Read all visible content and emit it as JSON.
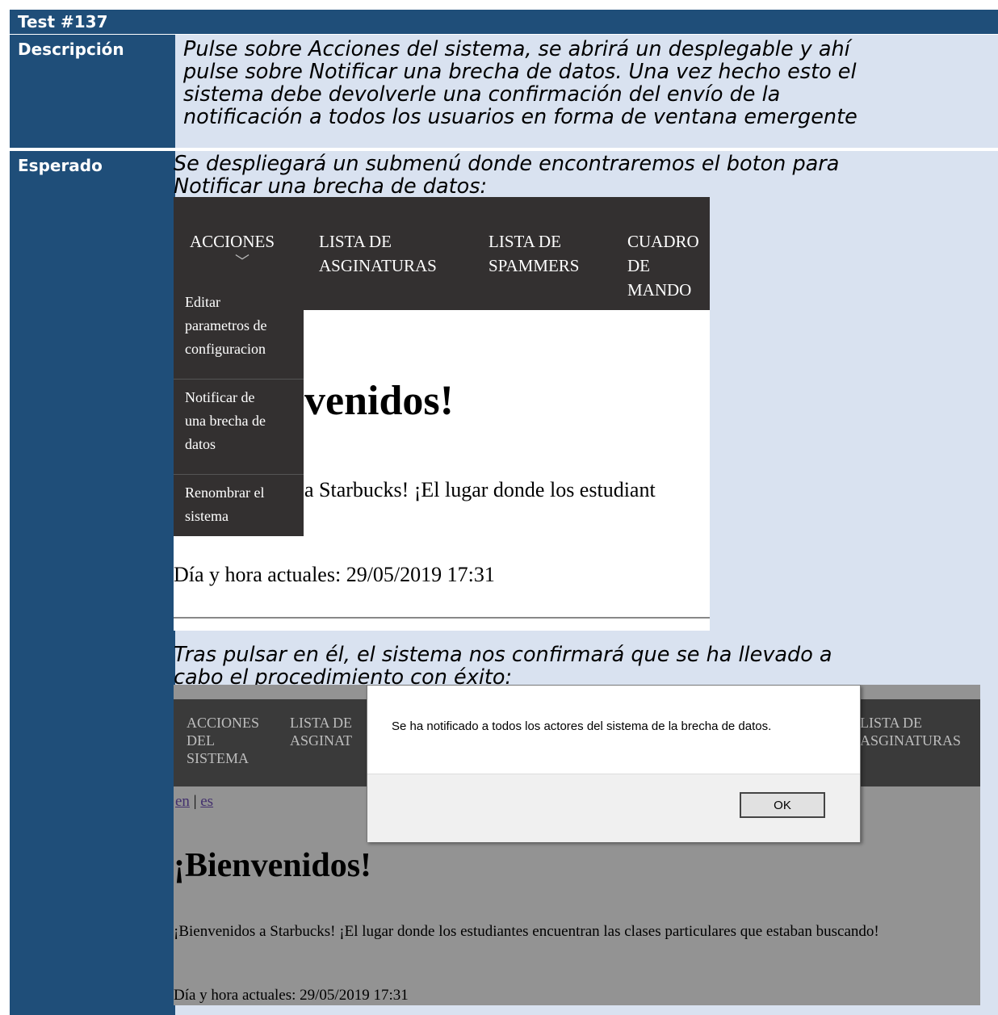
{
  "test": {
    "title": "Test #137"
  },
  "rows": {
    "description": {
      "label": "Descripción",
      "lines": [
        "Pulse sobre Acciones del sistema, se abrirá un desplegable y ahí",
        "pulse sobre Notificar una brecha de datos. Una vez hecho esto el",
        "sistema debe devolverle una confirmación del envío de la",
        "notificación a todos los usuarios en forma de ventana emergente"
      ]
    },
    "expected": {
      "label": "Esperado",
      "intro_lines": [
        "Se despliegará un submenú donde encontraremos el boton para",
        "Notificar una brecha de datos:"
      ],
      "after_lines": [
        "Tras pulsar en él, el sistema nos confirmará que se ha llevado a",
        "cabo el procedimiento con éxito:"
      ]
    }
  },
  "screenshot1": {
    "nav": [
      "ACCIONES",
      "LISTA DE\nASGINATURAS",
      "LISTA DE\nSPAMMERS",
      "CUADRO\nDE\nMANDO"
    ],
    "dropdown": [
      "Editar\nparametros de\nconfiguracion",
      "Notificar de\nuna brecha de\ndatos",
      "Renombrar el\nsistema"
    ],
    "heading": "venidos!",
    "text": "a Starbucks! ¡El lugar donde los estudiant",
    "date": "Día y hora actuales: 29/05/2019 17:31"
  },
  "screenshot2": {
    "nav": [
      "ACCIONES\nDEL\nSISTEMA",
      "LISTA DE\nASGINAT",
      "LISTA DE\nASGINATURAS"
    ],
    "lang_en": "en",
    "lang_sep": " | ",
    "lang_es": "es",
    "heading": "¡Bienvenidos!",
    "text": "¡Bienvenidos a Starbucks! ¡El lugar donde los estudiantes encuentran las clases particulares que estaban buscando!",
    "date": "Día y hora actuales: 29/05/2019 17:31",
    "dialog": {
      "message": "Se ha notificado a todos los actores del sistema de la brecha de datos.",
      "ok": "OK"
    }
  },
  "colors": {
    "header_blue": "#1f4e79",
    "cell_light": "#d9e2f0",
    "nav_dark": "#333030"
  }
}
